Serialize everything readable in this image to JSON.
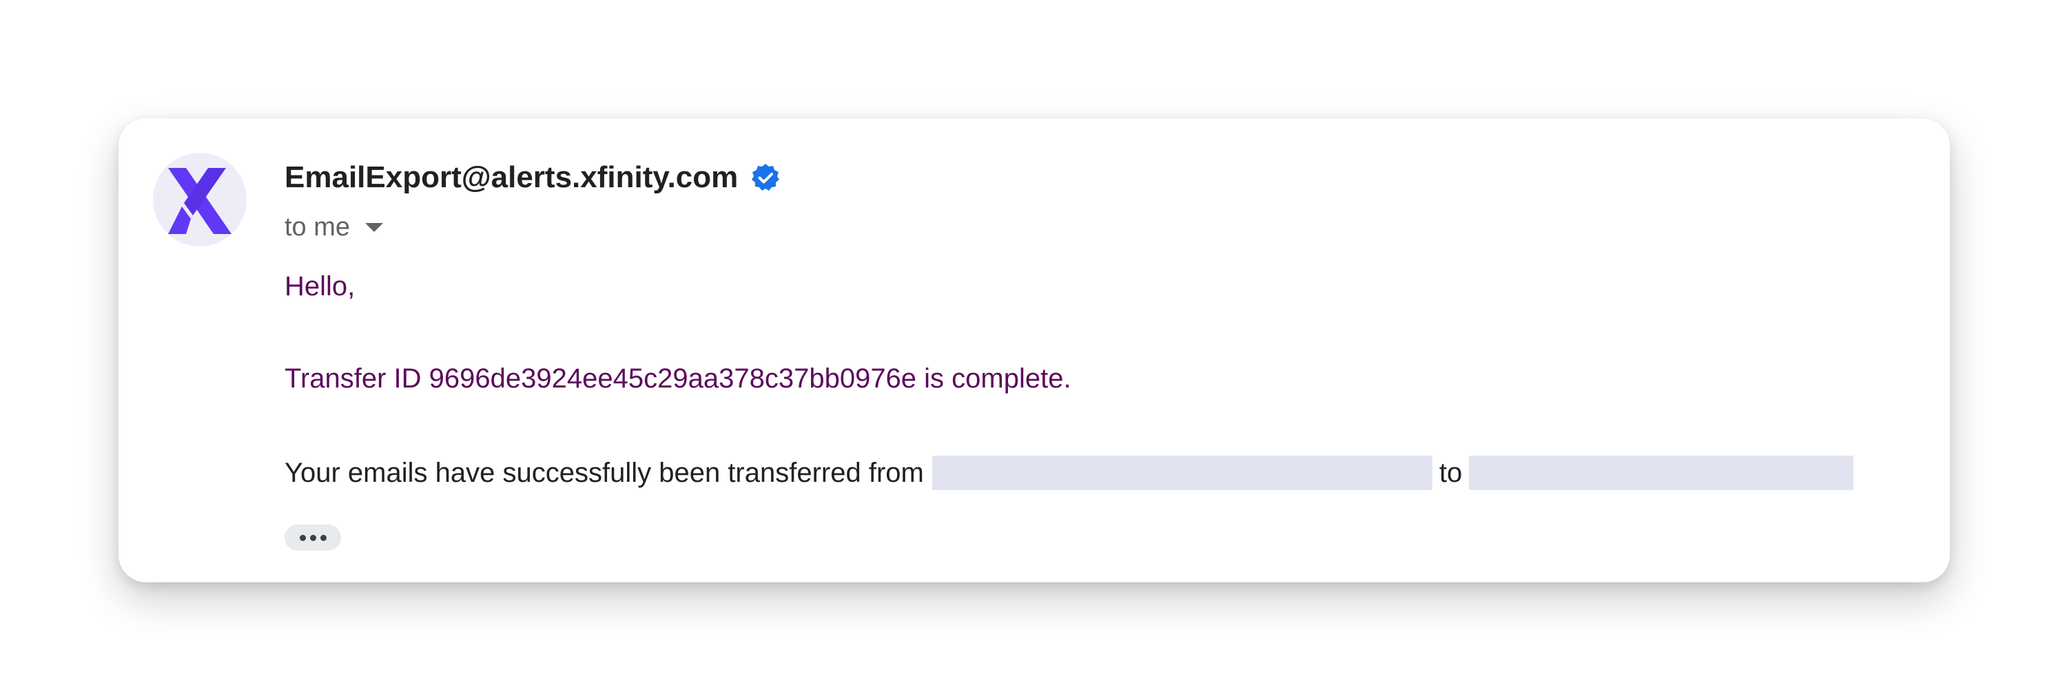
{
  "email": {
    "sender": "EmailExport@alerts.xfinity.com",
    "recipient_label": "to me",
    "greeting": "Hello,",
    "transfer_line": "Transfer ID 9696de3924ee45c29aa378c37bb0976e is complete.",
    "body_prefix": "Your emails have successfully been transferred from",
    "body_connector": "to"
  },
  "icons": {
    "avatar": "xfinity-x-logo",
    "verified": "verified-badge-icon",
    "expand": "caret-down-icon",
    "more": "more-horiz-icon"
  },
  "colors": {
    "brand_purple": "#6138f5",
    "verified_blue": "#1a73e8",
    "message_text": "#5c0a5c",
    "redaction": "#e1e4f0"
  }
}
